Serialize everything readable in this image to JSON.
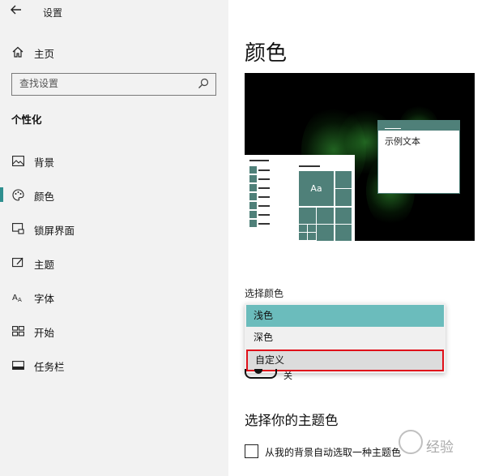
{
  "window": {
    "title": "设置"
  },
  "sidebar": {
    "home_label": "主页",
    "search_placeholder": "查找设置",
    "section_title": "个性化",
    "items": [
      {
        "label": "背景",
        "icon": "picture-icon",
        "active": false
      },
      {
        "label": "颜色",
        "icon": "palette-icon",
        "active": true
      },
      {
        "label": "锁屏界面",
        "icon": "lock-screen-icon",
        "active": false
      },
      {
        "label": "主题",
        "icon": "theme-icon",
        "active": false
      },
      {
        "label": "字体",
        "icon": "font-icon",
        "active": false
      },
      {
        "label": "开始",
        "icon": "start-icon",
        "active": false
      },
      {
        "label": "任务栏",
        "icon": "taskbar-icon",
        "active": false
      }
    ]
  },
  "main": {
    "title": "颜色",
    "preview": {
      "window_sample_text": "示例文本",
      "tile_text": "Aa"
    },
    "choose_color_label": "选择颜色",
    "dropdown": {
      "options": [
        "浅色",
        "深色",
        "自定义"
      ],
      "selected": "浅色",
      "highlighted": "自定义"
    },
    "toggle_text": "关",
    "accent_heading": "选择你的主题色",
    "auto_pick_label": "从我的背景自动选取一种主题色"
  },
  "watermark": {
    "text": "经验"
  },
  "colors": {
    "accent": "#4f8079",
    "selected_option": "#6bbcbc",
    "highlight_border": "#e0101a",
    "sidebar_bg": "#f2f2f2"
  }
}
